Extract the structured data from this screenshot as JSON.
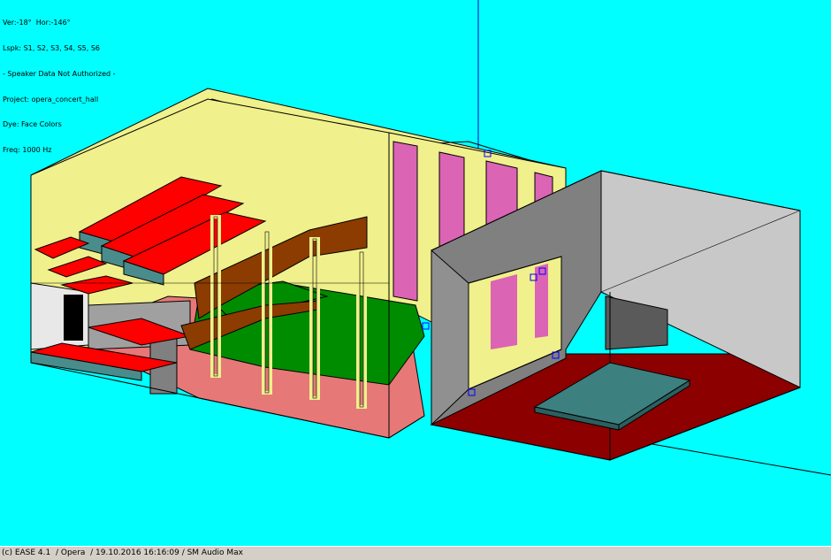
{
  "info": {
    "view": "Ver:-18°  Hor:-146°",
    "loudspeakers": "Lspk: S1, S2, S3, S4, S5, S6",
    "speaker_data": "- Speaker Data Not Authorized -",
    "project": "Project: opera_concert_hall",
    "dye": "Dye: Face Colors",
    "frequency": "Freq: 1000 Hz"
  },
  "status_bar": {
    "text": "(c) EASE 4.1  / Opera  / 19.10.2016 16:16:09 / SM Audio Max"
  },
  "colors": {
    "background": "#00ffff",
    "wall_yellow": "#f0f08c",
    "balcony_red": "#ff0000",
    "balcony_slab": "#4a8c8c",
    "stage_floor": "#008c00",
    "brown_beam": "#8c3c00",
    "pink_panel": "#dc64b4",
    "floor_salmon": "#e67878",
    "stage_grey": "#a0a0a0",
    "dark_red_floor": "#8c0000",
    "platform_teal": "#3c8080"
  },
  "loudspeaker_icons": [
    "S1",
    "S2",
    "S3",
    "S4",
    "S5",
    "S6"
  ]
}
